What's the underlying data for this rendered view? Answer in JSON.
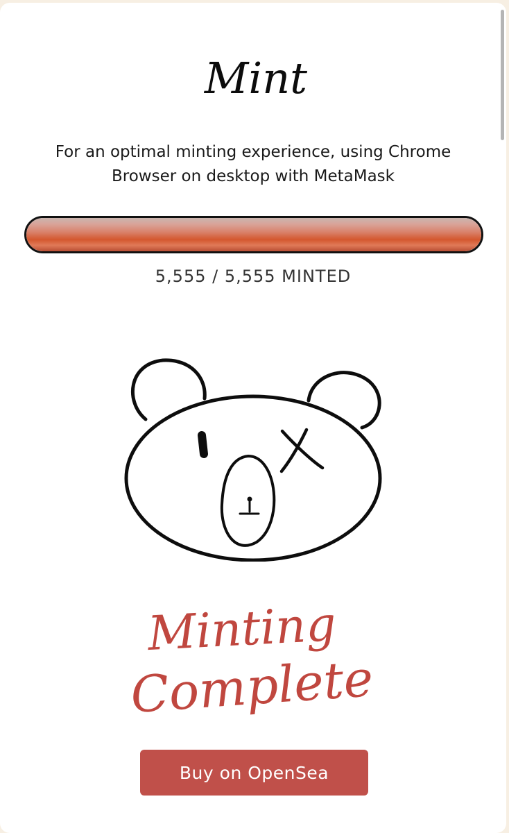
{
  "page": {
    "title": "Mint",
    "subtitle_line1": "For an optimal minting experience, using Chrome",
    "subtitle_line2": "Browser on desktop with MetaMask"
  },
  "progress": {
    "minted": 5555,
    "total": 5555,
    "fraction": 1.0,
    "label": "5,555 / 5,555 MINTED"
  },
  "artwork": {
    "icon": "bear-face-icon"
  },
  "status": {
    "line1": "Minting",
    "line2": "Complete"
  },
  "actions": {
    "buy_label": "Buy on OpenSea"
  },
  "colors": {
    "accent": "#c0504a",
    "status_text": "#c0473f",
    "progress_fill": "#d4572e"
  }
}
